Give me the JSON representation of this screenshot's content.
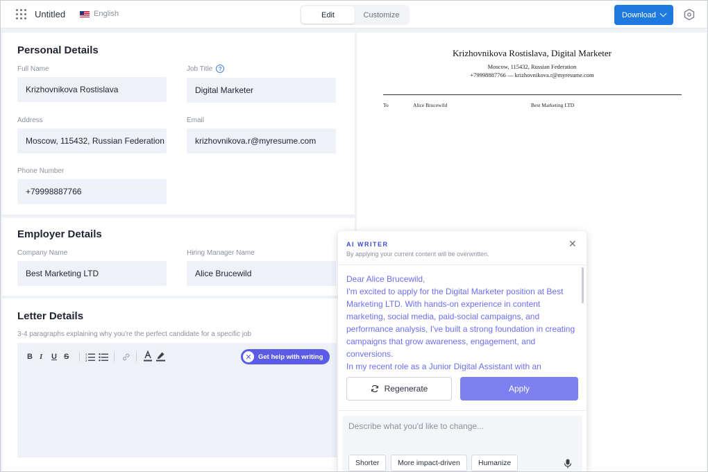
{
  "topbar": {
    "doc_title": "Untitled",
    "language": "English",
    "tabs": [
      {
        "label": "Edit",
        "active": true
      },
      {
        "label": "Customize",
        "active": false
      }
    ],
    "download_label": "Download",
    "accent_color": "#1f7ae0"
  },
  "personal": {
    "title": "Personal Details",
    "full_name": {
      "label": "Full Name",
      "value": "Krizhovnikova Rostislava"
    },
    "job_title": {
      "label": "Job Title",
      "value": "Digital Marketer"
    },
    "address": {
      "label": "Address",
      "value": "Moscow, 115432, Russian Federation"
    },
    "email": {
      "label": "Email",
      "value": "krizhovnikova.r@myresume.com"
    },
    "phone": {
      "label": "Phone Number",
      "value": "+79998887766"
    }
  },
  "employer": {
    "title": "Employer Details",
    "company": {
      "label": "Company Name",
      "value": "Best Marketing LTD"
    },
    "manager": {
      "label": "Hiring Manager Name",
      "value": "Alice Brucewild"
    }
  },
  "letter": {
    "title": "Letter Details",
    "subtitle": "3-4 paragraphs explaining why you're the perfect candidate for a specific job",
    "toolbar": {
      "bold": "B",
      "italic": "I",
      "underline": "U",
      "strike": "S"
    },
    "help_button": "Get help with writing"
  },
  "preview": {
    "name": "Krizhovnikova Rostislava, Digital Marketer",
    "address": "Moscow, 115432, Russian Federation",
    "contact": "+79998887766 — krizhovnikova.r@myresume.com",
    "to_label": "To",
    "to_name": "Alice Brucewild",
    "to_company": "Best Marketing LTD"
  },
  "ai_writer": {
    "title": "AI WRITER",
    "subtitle": "By applying your current content will be overwritten.",
    "text_color": "#6b6ef2",
    "paragraphs": [
      "Dear Alice Brucewild,",
      "I'm excited to apply for the Digital Marketer position at Best Marketing LTD. With hands-on experience in content marketing, social media, paid-social campaigns, and performance analysis, I've built a strong foundation in creating campaigns that grow awareness, engagement, and conversions.",
      "In my recent role as a Junior Digital Assistant with an"
    ],
    "regenerate_label": "Regenerate",
    "apply_label": "Apply",
    "prompt_placeholder": "Describe what you'd like to change...",
    "chips": [
      "Shorter",
      "More impact-driven",
      "Humanize"
    ]
  }
}
